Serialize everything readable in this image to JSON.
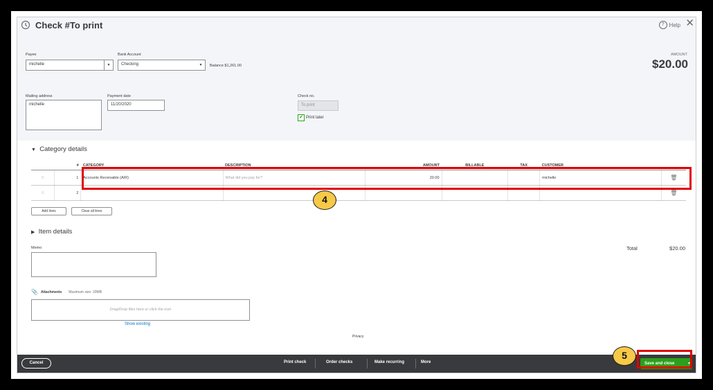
{
  "window": {
    "title": "Check #To print",
    "help_label": "Help"
  },
  "payee": {
    "label": "Payee",
    "value": "michelle"
  },
  "bank_account": {
    "label": "Bank Account",
    "value": "Checking",
    "balance": "Balance $1,261.00"
  },
  "amount": {
    "label": "AMOUNT",
    "value": "$20.00"
  },
  "mailing_address": {
    "label": "Mailing address",
    "value": "michelle"
  },
  "payment_date": {
    "label": "Payment date",
    "value": "11/20/2020"
  },
  "check_no": {
    "label": "Check no.",
    "value": "To print"
  },
  "print_later": {
    "label": "Print later",
    "checked": true
  },
  "category_details": {
    "title": "Category details",
    "columns": {
      "num": "#",
      "category": "CATEGORY",
      "description": "DESCRIPTION",
      "amount": "AMOUNT",
      "billable": "BILLABLE",
      "tax": "TAX",
      "customer": "CUSTOMER"
    },
    "rows": [
      {
        "num": "1",
        "category": "Accounts Receivable (A/R)",
        "description_placeholder": "What did you pay for?",
        "amount": "20.00",
        "customer": "michelle"
      },
      {
        "num": "2",
        "category": "",
        "description_placeholder": "",
        "amount": "",
        "customer": ""
      }
    ],
    "add_lines": "Add lines",
    "clear_lines": "Clear all lines"
  },
  "item_details": {
    "title": "Item details"
  },
  "memo": {
    "label": "Memo"
  },
  "total": {
    "label": "Total",
    "value": "$20.00"
  },
  "attachments": {
    "label": "Attachments",
    "max_size": "Maximum size: 20MB",
    "drop_text": "Drag/Drop files here or click the icon",
    "show_existing": "Show existing"
  },
  "privacy": "Privacy",
  "footer": {
    "cancel": "Cancel",
    "print_check": "Print check",
    "order_checks": "Order checks",
    "make_recurring": "Make recurring",
    "more": "More",
    "save_and_close": "Save and close"
  },
  "callouts": {
    "step4": "4",
    "step5": "5"
  },
  "colors": {
    "save_green": "#2ca01c",
    "footer_bg": "#393a3d",
    "highlight_red": "#e00000",
    "callout_yellow": "#f7c948"
  }
}
